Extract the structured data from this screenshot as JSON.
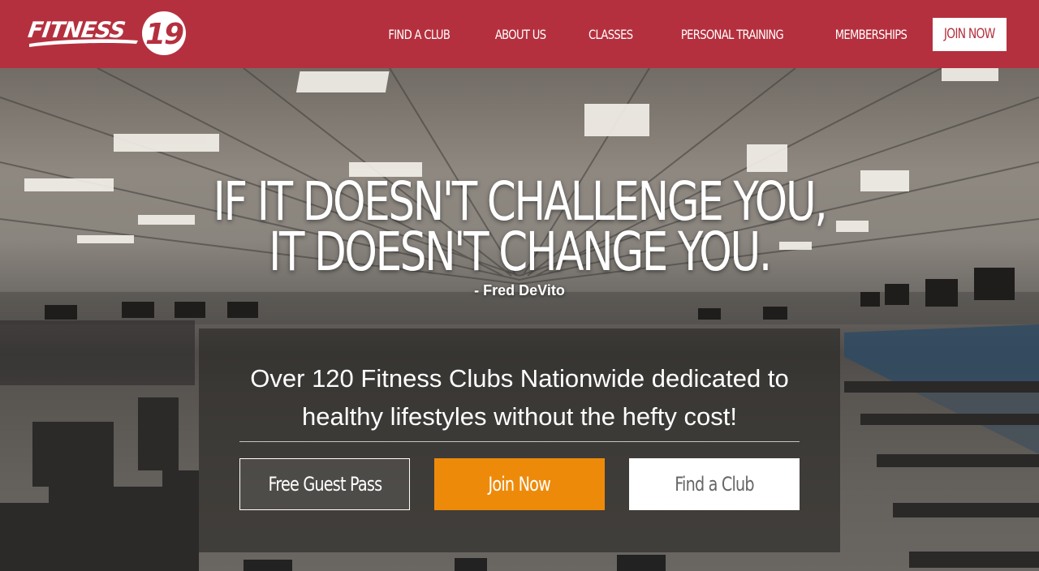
{
  "brand": {
    "name": "Fitness 19",
    "logo_word": "FITNESS",
    "logo_number": "19",
    "primary_color": "#b5303e",
    "accent_color": "#ee8a0a"
  },
  "nav": {
    "items": [
      {
        "label": "FIND A CLUB"
      },
      {
        "label": "ABOUT US"
      },
      {
        "label": "CLASSES"
      },
      {
        "label": "PERSONAL TRAINING"
      },
      {
        "label": "MEMBERSHIPS"
      }
    ],
    "join_label": "JOIN NOW"
  },
  "hero": {
    "quote_line_1": "IF IT DOESN'T CHALLENGE YOU,",
    "quote_line_2": "IT DOESN'T CHANGE YOU.",
    "quote_author": "- Fred DeVito",
    "panel_text_line_1": "Over 120 Fitness Clubs Nationwide dedicated to",
    "panel_text_line_2": "healthy lifestyles without the hefty cost!",
    "buttons": {
      "guest_pass": "Free Guest Pass",
      "join": "Join Now",
      "find": "Find a Club"
    }
  }
}
